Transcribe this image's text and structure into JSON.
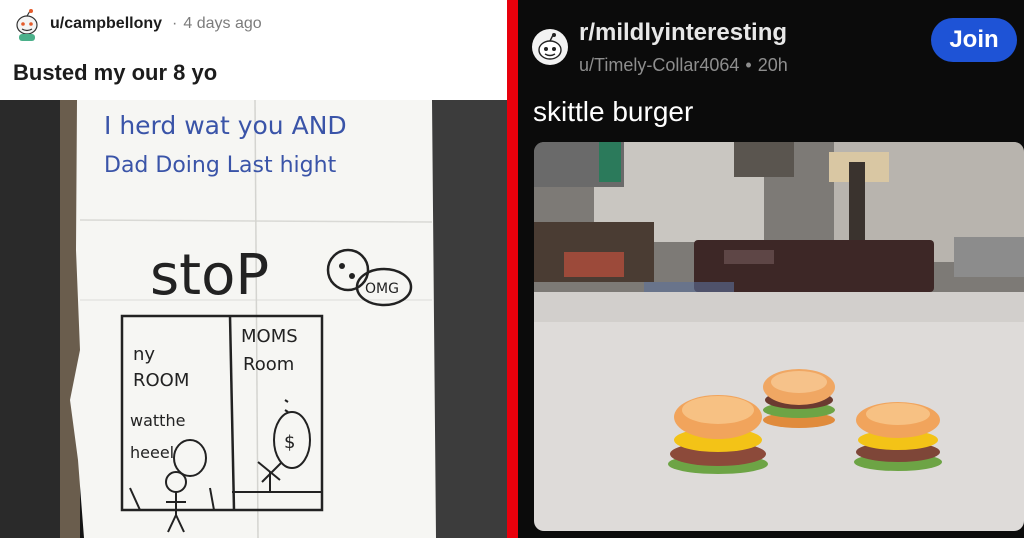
{
  "left_post": {
    "username": "u/campbellony",
    "separator": "·",
    "time": "4 days ago",
    "title": "Busted my our 8 yo",
    "note": {
      "line1": "I herd wat you AND",
      "line2": "Dad Doing Last hight",
      "stop": "stoP",
      "omg": "OMG",
      "my_room": [
        "ny",
        "ROOM"
      ],
      "moms_room": [
        "MOMS",
        "Room"
      ],
      "caption": [
        "watthe",
        "heeel"
      ]
    }
  },
  "right_post": {
    "subreddit": "r/mildlyinteresting",
    "username": "u/Timely-Collar4064",
    "separator": "•",
    "time": "20h",
    "join_label": "Join",
    "title": "skittle burger"
  },
  "colors": {
    "divider": "#e8000c",
    "join_button": "#1e53d6",
    "left_header_bg": "#ffffff",
    "right_bg": "#0b0b0b"
  },
  "icons": {
    "left_avatar": "snoo-avatar-icon",
    "right_avatar": "snoo-avatar-icon"
  }
}
